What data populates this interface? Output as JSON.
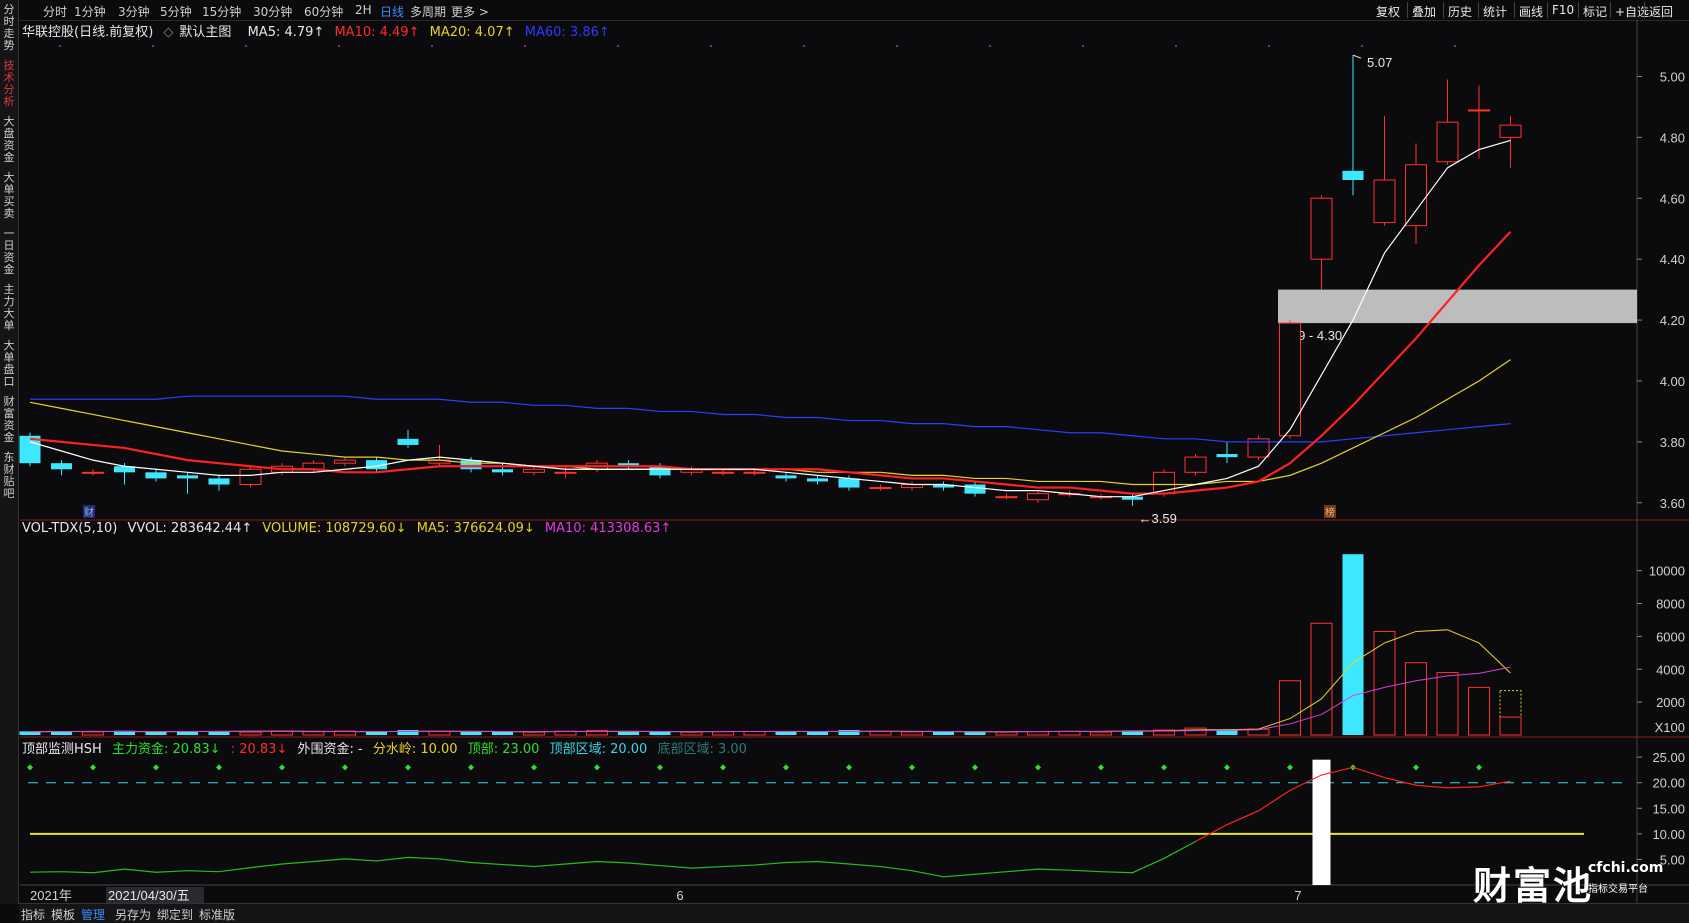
{
  "sidebar_tabs": [
    "分时走势",
    "技术分析",
    "大盘资金",
    "大单买卖",
    "一日资金",
    "主力大单",
    "大单盘口",
    "财富资金",
    "东财贴吧"
  ],
  "sidebar_active": 1,
  "periods": [
    "分时",
    "1分钟",
    "3分钟",
    "5分钟",
    "15分钟",
    "30分钟",
    "60分钟",
    "2H",
    "日线",
    "多周期",
    "更多 >"
  ],
  "period_active": "日线",
  "right_tools": [
    "复权",
    "叠加",
    "历史",
    "统计",
    "画线",
    "F10",
    "标记",
    "+自选",
    "返回"
  ],
  "main_legend": {
    "stock": "华联控股(日线.前复权)",
    "template": "默认主图",
    "ma5": "MA5: 4.79↑",
    "ma10": "MA10: 4.49↑",
    "ma20": "MA20: 4.07↑",
    "ma60": "MA60: 3.86↑"
  },
  "vol_legend": {
    "name": "VOL-TDX(5,10)",
    "vvol": "VVOL: 283642.44↑",
    "volume": "VOLUME: 108729.60↓",
    "ma5": "MA5: 376624.09↓",
    "ma10": "MA10: 413308.63↑"
  },
  "ind_legend": {
    "name": "顶部监测HSH",
    "main": "主力资金: 20.83↓",
    "main2": ": 20.83↓",
    "outer": "外围资金: -",
    "divide": "分水岭: 10.00",
    "top": "顶部: 23.00",
    "topzone": "顶部区域: 20.00",
    "bottomzone": "底部区域: 3.00"
  },
  "price_axis": [
    "5.00",
    "4.80",
    "4.60",
    "4.40",
    "4.20",
    "4.00",
    "3.80",
    "3.60"
  ],
  "vol_axis": [
    "10000",
    "8000",
    "6000",
    "4000",
    "2000"
  ],
  "vol_unit": "X100",
  "ind_axis": [
    "25.00",
    "20.00",
    "15.00",
    "10.00",
    "5.00"
  ],
  "annotations": {
    "high": "5.07",
    "low": "3.59",
    "zone": "4.19 - 4.30",
    "bang": "榜",
    "cai": "财"
  },
  "date_axis": {
    "year": "2021年",
    "cursor": "2021/04/30/五",
    "m6": "6",
    "m7": "7"
  },
  "bottom_tabs": [
    "指标",
    "模板",
    "管理",
    "另存为",
    "绑定到",
    "标准版"
  ],
  "bottom_active": "管理",
  "watermark": {
    "brand": "财富池",
    "site": "cfchi.com",
    "slogan": "指标交易平台"
  },
  "candles": [
    [
      3.82,
      3.73,
      3.83,
      3.72
    ],
    [
      3.73,
      3.71,
      3.74,
      3.69
    ],
    [
      3.7,
      3.7,
      3.71,
      3.69
    ],
    [
      3.72,
      3.7,
      3.73,
      3.66
    ],
    [
      3.7,
      3.68,
      3.71,
      3.67
    ],
    [
      3.69,
      3.68,
      3.7,
      3.63
    ],
    [
      3.68,
      3.66,
      3.69,
      3.64
    ],
    [
      3.66,
      3.71,
      3.72,
      3.65
    ],
    [
      3.7,
      3.72,
      3.73,
      3.69
    ],
    [
      3.71,
      3.73,
      3.74,
      3.7
    ],
    [
      3.73,
      3.74,
      3.75,
      3.72
    ],
    [
      3.74,
      3.71,
      3.75,
      3.7
    ],
    [
      3.81,
      3.79,
      3.84,
      3.78
    ],
    [
      3.73,
      3.74,
      3.79,
      3.72
    ],
    [
      3.74,
      3.71,
      3.75,
      3.7
    ],
    [
      3.71,
      3.7,
      3.73,
      3.69
    ],
    [
      3.7,
      3.71,
      3.72,
      3.69
    ],
    [
      3.7,
      3.7,
      3.72,
      3.68
    ],
    [
      3.71,
      3.73,
      3.74,
      3.7
    ],
    [
      3.73,
      3.72,
      3.74,
      3.71
    ],
    [
      3.72,
      3.69,
      3.73,
      3.68
    ],
    [
      3.7,
      3.71,
      3.72,
      3.69
    ],
    [
      3.7,
      3.7,
      3.71,
      3.69
    ],
    [
      3.7,
      3.7,
      3.71,
      3.69
    ],
    [
      3.69,
      3.68,
      3.7,
      3.67
    ],
    [
      3.68,
      3.67,
      3.69,
      3.66
    ],
    [
      3.68,
      3.65,
      3.69,
      3.64
    ],
    [
      3.65,
      3.65,
      3.66,
      3.64
    ],
    [
      3.65,
      3.66,
      3.67,
      3.64
    ],
    [
      3.66,
      3.65,
      3.67,
      3.64
    ],
    [
      3.66,
      3.63,
      3.67,
      3.62
    ],
    [
      3.62,
      3.62,
      3.63,
      3.61
    ],
    [
      3.61,
      3.63,
      3.64,
      3.6
    ],
    [
      3.63,
      3.63,
      3.64,
      3.62
    ],
    [
      3.62,
      3.62,
      3.63,
      3.61
    ],
    [
      3.62,
      3.61,
      3.63,
      3.59
    ],
    [
      3.63,
      3.7,
      3.71,
      3.62
    ],
    [
      3.7,
      3.75,
      3.76,
      3.69
    ],
    [
      3.76,
      3.75,
      3.8,
      3.73
    ],
    [
      3.75,
      3.81,
      3.82,
      3.74
    ],
    [
      3.82,
      4.19,
      4.2,
      3.81
    ],
    [
      4.4,
      4.6,
      4.61,
      4.3
    ],
    [
      4.69,
      4.66,
      5.07,
      4.61
    ],
    [
      4.52,
      4.66,
      4.87,
      4.51
    ],
    [
      4.51,
      4.71,
      4.78,
      4.45
    ],
    [
      4.72,
      4.85,
      4.99,
      4.71
    ],
    [
      4.89,
      4.89,
      4.97,
      4.73
    ],
    [
      4.8,
      4.84,
      4.87,
      4.7
    ]
  ],
  "ma5": [
    3.8,
    3.77,
    3.74,
    3.72,
    3.71,
    3.7,
    3.69,
    3.69,
    3.7,
    3.7,
    3.71,
    3.72,
    3.74,
    3.75,
    3.74,
    3.73,
    3.72,
    3.71,
    3.71,
    3.71,
    3.71,
    3.71,
    3.71,
    3.71,
    3.7,
    3.69,
    3.68,
    3.67,
    3.66,
    3.66,
    3.65,
    3.64,
    3.64,
    3.63,
    3.62,
    3.62,
    3.64,
    3.66,
    3.68,
    3.72,
    3.84,
    4.02,
    4.2,
    4.42,
    4.56,
    4.7,
    4.76,
    4.79
  ],
  "ma10": [
    3.81,
    3.8,
    3.79,
    3.78,
    3.76,
    3.74,
    3.73,
    3.72,
    3.71,
    3.71,
    3.7,
    3.7,
    3.71,
    3.72,
    3.72,
    3.72,
    3.72,
    3.72,
    3.72,
    3.72,
    3.72,
    3.71,
    3.71,
    3.71,
    3.71,
    3.71,
    3.7,
    3.69,
    3.68,
    3.68,
    3.67,
    3.66,
    3.65,
    3.65,
    3.64,
    3.63,
    3.63,
    3.64,
    3.65,
    3.67,
    3.73,
    3.82,
    3.92,
    4.03,
    4.14,
    4.26,
    4.38,
    4.49
  ],
  "ma20": [
    3.93,
    3.91,
    3.89,
    3.87,
    3.85,
    3.83,
    3.81,
    3.79,
    3.77,
    3.76,
    3.75,
    3.75,
    3.74,
    3.74,
    3.73,
    3.73,
    3.72,
    3.72,
    3.71,
    3.71,
    3.71,
    3.71,
    3.71,
    3.71,
    3.71,
    3.7,
    3.7,
    3.7,
    3.69,
    3.69,
    3.68,
    3.68,
    3.67,
    3.67,
    3.67,
    3.66,
    3.66,
    3.66,
    3.67,
    3.67,
    3.69,
    3.73,
    3.78,
    3.83,
    3.88,
    3.94,
    4.0,
    4.07
  ],
  "ma60": [
    3.94,
    3.94,
    3.94,
    3.94,
    3.94,
    3.95,
    3.95,
    3.95,
    3.95,
    3.95,
    3.95,
    3.94,
    3.94,
    3.94,
    3.93,
    3.93,
    3.92,
    3.92,
    3.91,
    3.91,
    3.9,
    3.9,
    3.89,
    3.89,
    3.88,
    3.88,
    3.87,
    3.87,
    3.86,
    3.86,
    3.85,
    3.85,
    3.84,
    3.83,
    3.83,
    3.82,
    3.81,
    3.81,
    3.8,
    3.8,
    3.8,
    3.8,
    3.81,
    3.82,
    3.83,
    3.84,
    3.85,
    3.86
  ],
  "volume": [
    220,
    200,
    190,
    260,
    210,
    230,
    200,
    180,
    230,
    200,
    240,
    220,
    300,
    210,
    190,
    200,
    180,
    230,
    260,
    190,
    200,
    180,
    200,
    210,
    230,
    200,
    300,
    210,
    190,
    200,
    170,
    180,
    200,
    220,
    180,
    260,
    300,
    420,
    330,
    350,
    3300,
    6800,
    11000,
    6300,
    4400,
    3800,
    2900,
    1090
  ],
  "vol_ma5": [
    200,
    210,
    220,
    210,
    200,
    210,
    220,
    230,
    230,
    220,
    210,
    200,
    220,
    230,
    220,
    210,
    200,
    210,
    220,
    220,
    210,
    200,
    210,
    210,
    220,
    210,
    220,
    230,
    220,
    210,
    200,
    200,
    210,
    220,
    220,
    240,
    260,
    310,
    330,
    360,
    1000,
    2200,
    4400,
    5600,
    6300,
    6400,
    5600,
    3770
  ],
  "vol_ma10": [
    200,
    205,
    210,
    210,
    205,
    210,
    215,
    220,
    225,
    220,
    215,
    210,
    215,
    220,
    220,
    215,
    210,
    210,
    215,
    220,
    215,
    210,
    210,
    210,
    215,
    210,
    215,
    220,
    220,
    215,
    205,
    205,
    210,
    215,
    215,
    225,
    240,
    270,
    290,
    320,
    680,
    1250,
    2400,
    2900,
    3300,
    3600,
    3750,
    4130
  ],
  "ind_main": [
    2.5,
    2.6,
    2.4,
    3.1,
    2.5,
    2.8,
    2.6,
    3.4,
    4.1,
    4.6,
    5.1,
    4.7,
    5.4,
    5.1,
    4.4,
    4.0,
    3.6,
    4.1,
    4.6,
    4.3,
    3.8,
    3.3,
    3.6,
    3.9,
    4.4,
    4.6,
    4.1,
    3.6,
    2.8,
    1.6,
    2.1,
    2.6,
    3.1,
    2.9,
    2.6,
    2.4,
    5.2,
    8.5,
    11.8,
    14.5,
    18.5,
    21.5,
    23.0,
    21.0,
    19.5,
    19.0,
    19.2,
    20.3,
    20.83
  ]
}
